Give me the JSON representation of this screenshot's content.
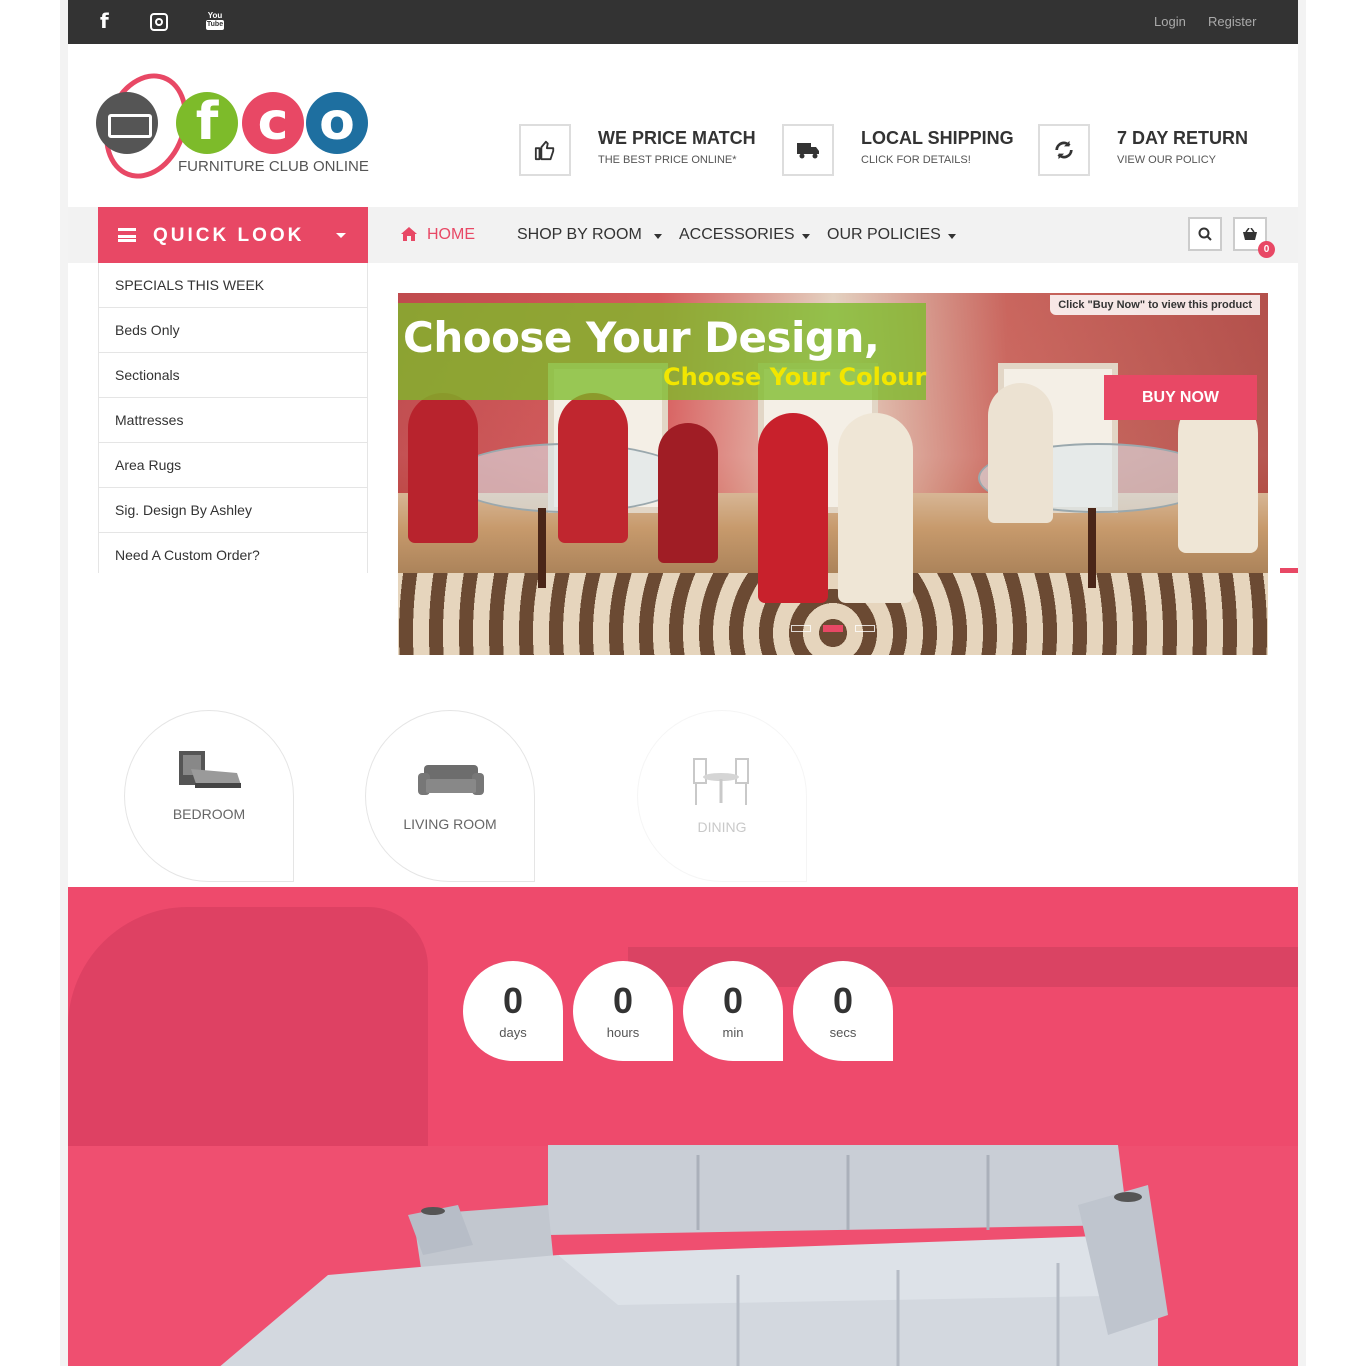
{
  "topbar": {
    "social": [
      "facebook-icon",
      "instagram-icon",
      "youtube-icon"
    ],
    "youtube_top": "You",
    "youtube_bottom": "Tube",
    "login": "Login",
    "register": "Register"
  },
  "logo": {
    "letters": [
      "f",
      "c",
      "o"
    ],
    "tagline": "FURNITURE CLUB ONLINE"
  },
  "features": [
    {
      "icon": "thumbs-up-icon",
      "title": "WE PRICE MATCH",
      "subtitle": "THE BEST PRICE ONLINE*"
    },
    {
      "icon": "truck-icon",
      "title": "LOCAL SHIPPING",
      "subtitle": "CLICK FOR DETAILS!"
    },
    {
      "icon": "refresh-icon",
      "title": "7 DAY RETURN",
      "subtitle": "VIEW OUR POLICY"
    }
  ],
  "quicklook": {
    "label": "QUICK LOOK",
    "items": [
      "SPECIALS THIS WEEK",
      "Beds Only",
      "Sectionals",
      "Mattresses",
      "Area Rugs",
      "Sig. Design By Ashley",
      "Need A Custom Order?"
    ]
  },
  "nav": {
    "items": [
      "HOME",
      "SHOP BY ROOM",
      "ACCESSORIES",
      "OUR POLICIES"
    ],
    "cart_count": "0"
  },
  "slider": {
    "headline": "Choose Your Design,",
    "subheadline": "Choose Your Colour",
    "note": "Click \"Buy Now\" to view this product",
    "button": "BUY NOW",
    "slide_count": 3,
    "active_slide": 2
  },
  "categories": [
    "BEDROOM",
    "LIVING ROOM",
    "DINING"
  ],
  "countdown": [
    {
      "value": "0",
      "unit": "days"
    },
    {
      "value": "0",
      "unit": "hours"
    },
    {
      "value": "0",
      "unit": "min"
    },
    {
      "value": "0",
      "unit": "secs"
    }
  ],
  "colors": {
    "accent": "#e84865",
    "topbar": "#333333",
    "logo_green": "#7dbb2a",
    "logo_blue": "#1e6fa0",
    "banner_green": "#7dbb2a",
    "banner_yellow": "#f2e600"
  }
}
